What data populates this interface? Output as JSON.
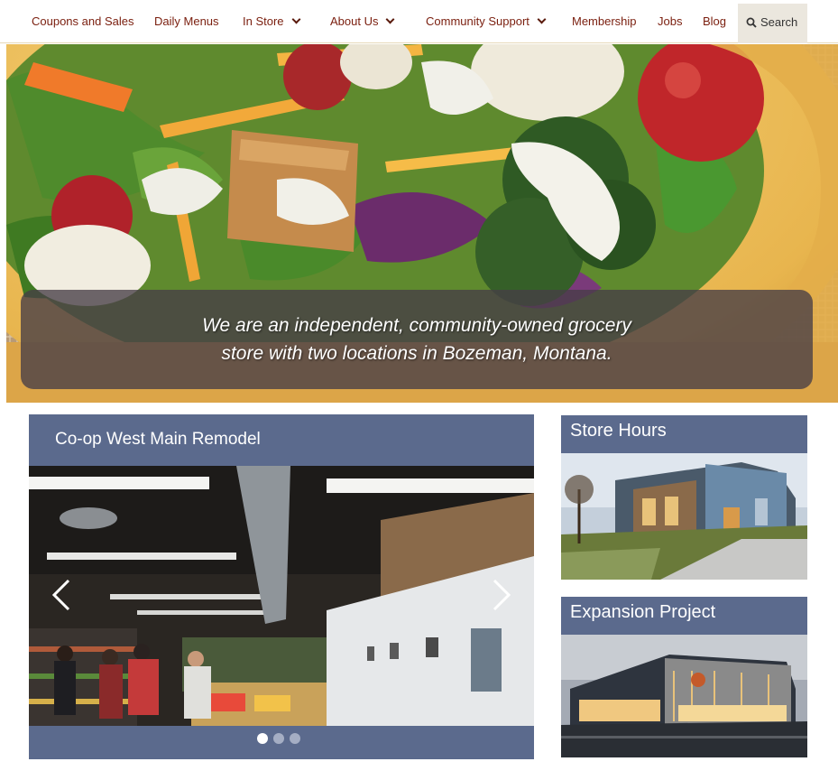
{
  "nav": {
    "items": [
      {
        "label": "Coupons and Sales"
      },
      {
        "label": "Daily Menus"
      },
      {
        "label": "In Store"
      },
      {
        "label": "About Us"
      },
      {
        "label": "Community Support"
      },
      {
        "label": "Membership"
      },
      {
        "label": "Jobs"
      },
      {
        "label": "Blog"
      }
    ],
    "search_label": "Search"
  },
  "hero": {
    "caption_line1": "We are an independent, community-owned grocery",
    "caption_line2": "store with two locations in Bozeman, Montana."
  },
  "slider": {
    "title": "Co-op West Main Remodel",
    "slides_total": 3,
    "active_slide": 1
  },
  "store_hours": {
    "title": "Store Hours"
  },
  "expansion": {
    "title": "Expansion Project"
  },
  "colors": {
    "nav_link": "#7a1e0e",
    "card_header": "#5b6a8d",
    "search_bg": "#ebe7de"
  }
}
